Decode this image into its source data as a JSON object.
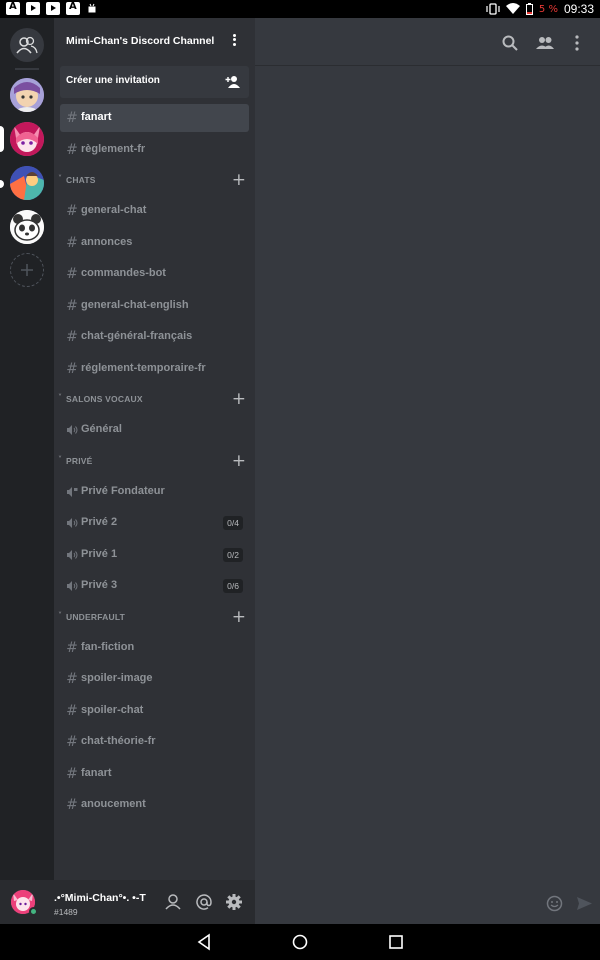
{
  "status_bar": {
    "time": "09:33",
    "battery": "5 %"
  },
  "server_rail": {
    "servers": [
      "dm",
      "server-1",
      "server-2",
      "server-3",
      "server-4"
    ]
  },
  "guild": {
    "name": "Mimi-Chan's Discord Channel",
    "invite_label": "Créer une invitation"
  },
  "channels_top": [
    {
      "name": "fanart",
      "type": "text",
      "active": true
    },
    {
      "name": "règlement-fr",
      "type": "text"
    }
  ],
  "categories": [
    {
      "name": "CHATS",
      "channels": [
        {
          "name": "general-chat",
          "type": "text"
        },
        {
          "name": "annonces",
          "type": "text"
        },
        {
          "name": "commandes-bot",
          "type": "text"
        },
        {
          "name": "general-chat-english",
          "type": "text"
        },
        {
          "name": "chat-général-français",
          "type": "text"
        },
        {
          "name": "réglement-temporaire-fr",
          "type": "text"
        }
      ]
    },
    {
      "name": "SALONS VOCAUX",
      "channels": [
        {
          "name": "Général",
          "type": "voice"
        }
      ]
    },
    {
      "name": "PRIVÉ",
      "channels": [
        {
          "name": "Privé Fondateur",
          "type": "voice-locked"
        },
        {
          "name": "Privé 2",
          "type": "voice",
          "count": "0/4"
        },
        {
          "name": "Privé 1",
          "type": "voice",
          "count": "0/2"
        },
        {
          "name": "Privé 3",
          "type": "voice",
          "count": "0/6"
        }
      ]
    },
    {
      "name": "UNDERFAULT",
      "channels": [
        {
          "name": "fan-fiction",
          "type": "text"
        },
        {
          "name": "spoiler-image",
          "type": "text"
        },
        {
          "name": "spoiler-chat",
          "type": "text"
        },
        {
          "name": "chat-théorie-fr",
          "type": "text"
        },
        {
          "name": "fanart",
          "type": "text"
        },
        {
          "name": "anoucement",
          "type": "text"
        }
      ]
    }
  ],
  "user": {
    "name": ".•°Mimi-Chan°•. •-T",
    "discriminator": "#1489",
    "status": "online"
  },
  "colors": {
    "rail": "#202225",
    "sidebar": "#2f3136",
    "chat": "#36393f",
    "online": "#43b581"
  }
}
